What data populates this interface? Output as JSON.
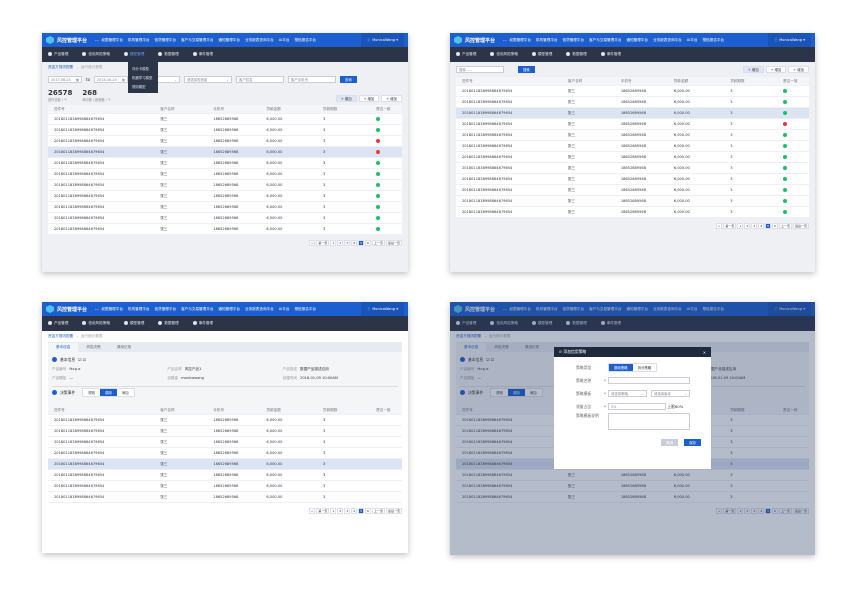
{
  "app": {
    "title": "风控管理平台",
    "more": "···",
    "user": "MonicaWang",
    "menu": [
      "权限管理平台",
      "机构管理平台",
      "信贷管理平台",
      "客户与交易管理平台",
      "通知管理平台",
      "业务报表查询平台",
      "AI平台",
      "想信报告平台"
    ],
    "subnav": [
      "产品管理",
      "信用风险策略",
      "模型管理",
      "数据管理",
      "事件管理"
    ]
  },
  "dropdown": [
    "评分卡模型",
    "机器学习模型",
    "规则模型"
  ],
  "breadcrumb": {
    "parent": "资金方规则配置",
    "current": "运行统计报表"
  },
  "filters": {
    "date_from": "2017-08-24",
    "to": "to",
    "date_to": "2018-08-24",
    "select1": "请选择",
    "select2": "请选择规则组",
    "name_ph": "客户姓名",
    "phone_ph": "客户手机号",
    "query": "查询",
    "search_ph": "搜索......",
    "search_btn": "搜索"
  },
  "stats": [
    {
      "value": "26578",
      "label": "进件总数 / 个"
    },
    {
      "value": "268",
      "label": "命中数 / 拒绝数 / 个"
    }
  ],
  "add_buttons": [
    "+ 增加",
    "+ 增加",
    "+ 增加"
  ],
  "table": {
    "columns": [
      "进件号",
      "客户名称",
      "手机号",
      "贷款金额",
      "贷款期数",
      "是否一致"
    ],
    "row": {
      "id": "2018011838998864679654",
      "name": "张三",
      "phone": "18652689568",
      "amount": "6,000.00",
      "term": "3"
    },
    "status_a": [
      "ok",
      "ok",
      "no",
      "no",
      "ok",
      "ok",
      "ok",
      "ok",
      "ok",
      "ok",
      "ok"
    ],
    "status_b": [
      "ok",
      "ok",
      "ok",
      "no",
      "ok",
      "ok",
      "ok",
      "ok",
      "ok",
      "ok",
      "ok",
      "ok"
    ],
    "status_c": [
      "",
      "",
      "",
      "",
      "",
      "",
      "",
      ""
    ]
  },
  "pagination": [
    "<",
    "第一页",
    "1",
    "2",
    "3",
    "4",
    "5",
    "6",
    "上一页",
    "最后一页"
  ],
  "pagination_active": "5",
  "detail": {
    "tabs": [
      "基本信息",
      "风险决策",
      "调用记录"
    ],
    "section1": "基本信息",
    "section2": "决策事件",
    "fields": [
      [
        "产品编号",
        "fkcp-a"
      ],
      [
        "产品名称",
        "风控产品1"
      ],
      [
        "产品描述",
        "数据产品描述应用"
      ],
      [
        "产品模板",
        "—"
      ],
      [
        "创建者",
        "monicawang"
      ],
      [
        "创建时间",
        "2018-01-09 10:00AM"
      ]
    ],
    "segments": [
      "规则",
      "调用",
      "添加"
    ],
    "segment_active": 1,
    "edit_icons": "☑ ☑"
  },
  "modal": {
    "title": "添加信用策略",
    "type_label": "策略类型",
    "type_options": [
      "基础策略",
      "拆分策略"
    ],
    "name_label": "策略名称",
    "tpl_label": "策略模板",
    "tpl_ph1": "请选择策略",
    "tpl_ph2": "请选择版本",
    "ratio_label": "流量占比",
    "ratio_ph": "0%",
    "ratio_hint": "上限60%",
    "desc_label": "策略模板说明",
    "cancel": "取消",
    "save": "保存"
  },
  "colors": {
    "primary": "#1d5fcf",
    "nav_dark": "#2c3447",
    "ok": "#1fbf6a",
    "fail": "#e8393d"
  }
}
